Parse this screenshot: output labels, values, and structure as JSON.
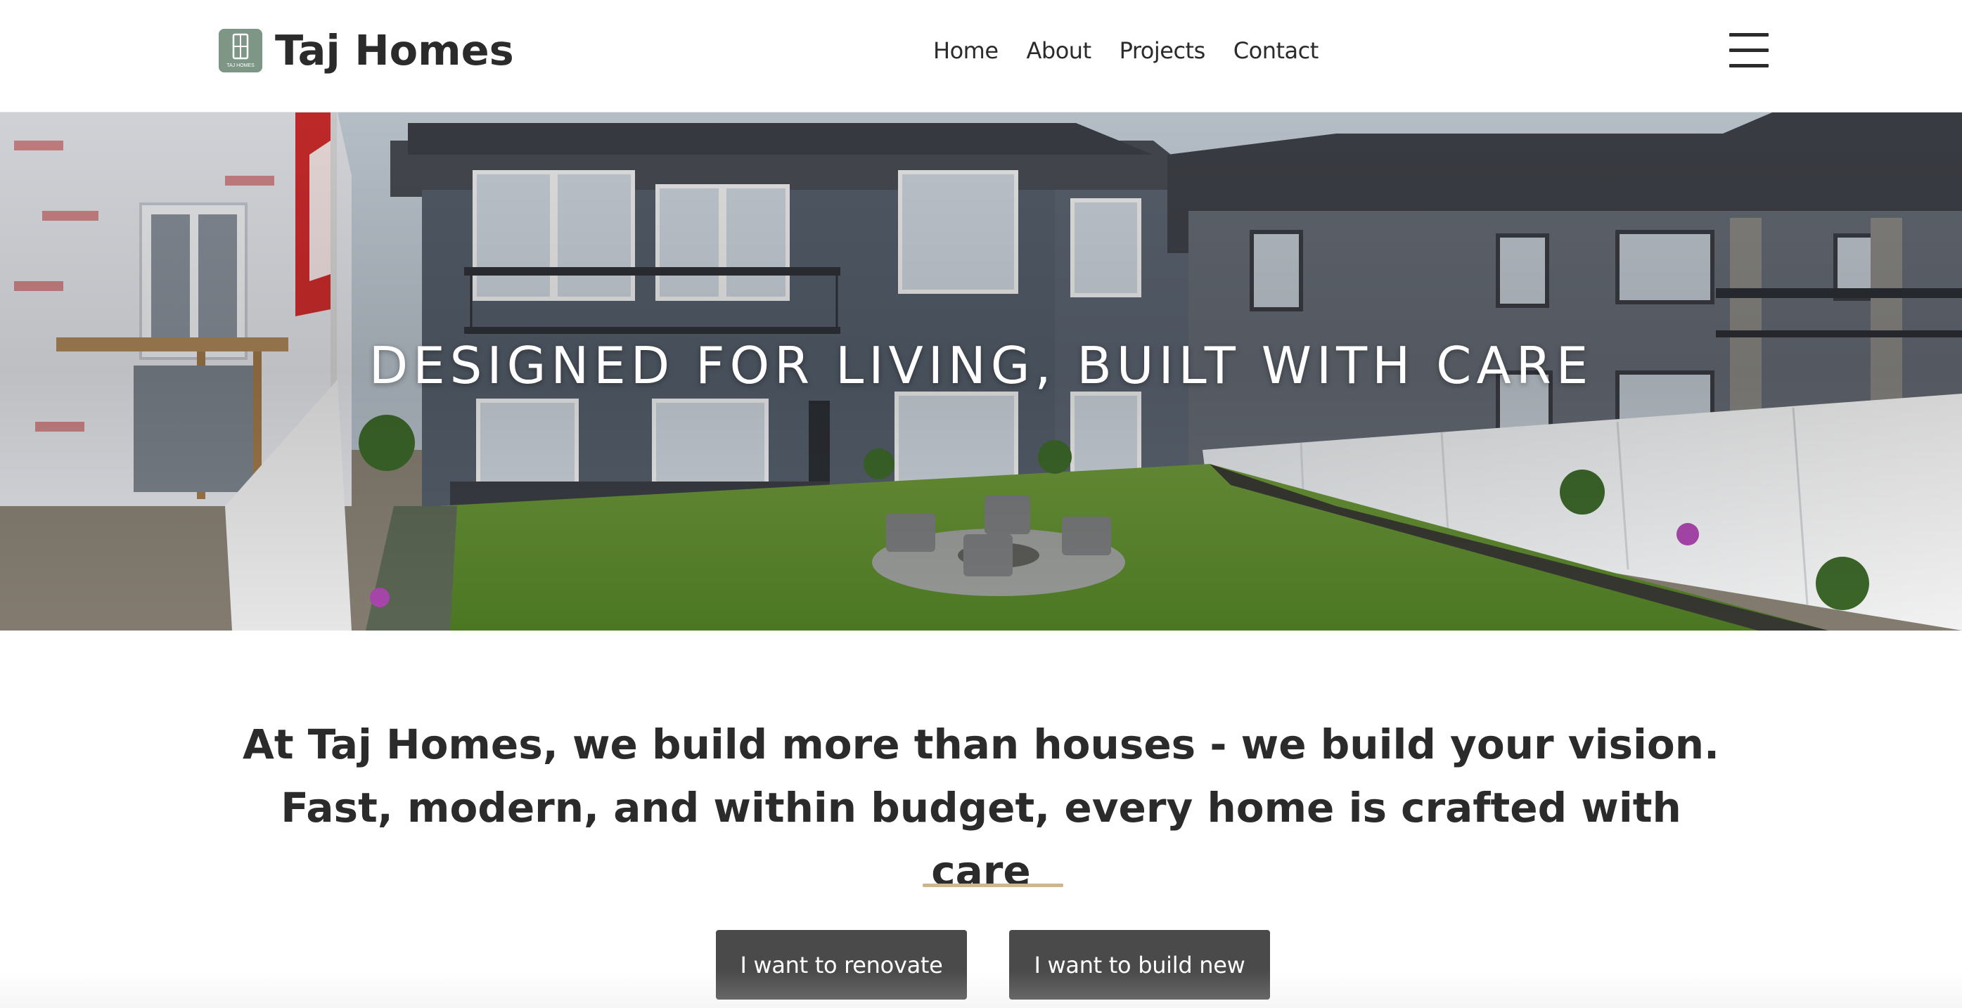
{
  "brand": {
    "name": "Taj Homes",
    "logo_icon": "taj-homes-logo-icon",
    "logo_text": "TAJ HOMES"
  },
  "nav": {
    "items": [
      {
        "label": "Home"
      },
      {
        "label": "About"
      },
      {
        "label": "Projects"
      },
      {
        "label": "Contact"
      }
    ],
    "menu_icon": "hamburger-menu-icon"
  },
  "hero": {
    "title": "DESIGNED FOR LIVING, BUILT WITH CARE",
    "image": "backyard-house-photo"
  },
  "intro": {
    "text": "At Taj Homes, we build more than houses - we build your vision. Fast, modern, and within budget, every home is crafted with care"
  },
  "cta": {
    "renovate_label": "I want to renovate",
    "build_label": "I want to build new"
  },
  "colors": {
    "accent_divider": "#cfb48e",
    "button_bg": "#4a4a4a",
    "logo_bg": "#7d9685",
    "text": "#2b2b2b"
  }
}
